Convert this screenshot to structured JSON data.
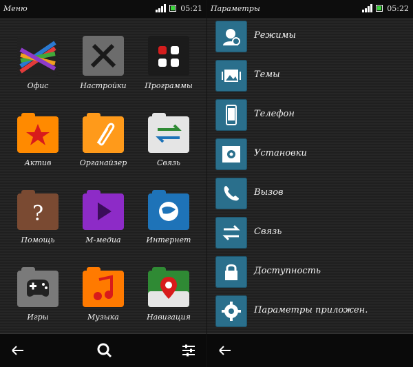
{
  "left": {
    "status": {
      "title": "Меню",
      "time": "05:21"
    },
    "apps": [
      {
        "label": "Офис",
        "icon": "office-icon",
        "color": "#222222"
      },
      {
        "label": "Настройки",
        "icon": "tools-icon",
        "color": "#6c6c6c"
      },
      {
        "label": "Программы",
        "icon": "apps-grid-icon",
        "color": "#1b1b1b"
      },
      {
        "label": "Актив",
        "icon": "star-folder-icon",
        "color": "#ff8a00"
      },
      {
        "label": "Органайзер",
        "icon": "paperclip-folder-icon",
        "color": "#ff9a1a"
      },
      {
        "label": "Связь",
        "icon": "transfer-folder-icon",
        "color": "#e5e5e5"
      },
      {
        "label": "Помощь",
        "icon": "help-folder-icon",
        "color": "#7a4a32"
      },
      {
        "label": "M-медиа",
        "icon": "play-folder-icon",
        "color": "#8d2bc7"
      },
      {
        "label": "Интернет",
        "icon": "globe-folder-icon",
        "color": "#1e73b8"
      },
      {
        "label": "Игры",
        "icon": "gamepad-folder-icon",
        "color": "#7a7a7a"
      },
      {
        "label": "Музыка",
        "icon": "music-folder-icon",
        "color": "#ff7a00"
      },
      {
        "label": "Навигация",
        "icon": "map-pin-folder-icon",
        "color": "#2f8a34"
      }
    ]
  },
  "right": {
    "status": {
      "title": "Параметры",
      "time": "05:22"
    },
    "items": [
      {
        "label": "Режимы",
        "icon": "profiles-icon"
      },
      {
        "label": "Темы",
        "icon": "themes-icon"
      },
      {
        "label": "Телефон",
        "icon": "phone-device-icon"
      },
      {
        "label": "Установки",
        "icon": "settings-gear-icon"
      },
      {
        "label": "Вызов",
        "icon": "call-icon"
      },
      {
        "label": "Связь",
        "icon": "transfer-icon"
      },
      {
        "label": "Доступность",
        "icon": "lock-icon"
      },
      {
        "label": "Параметры приложен.",
        "icon": "app-settings-icon"
      }
    ]
  }
}
